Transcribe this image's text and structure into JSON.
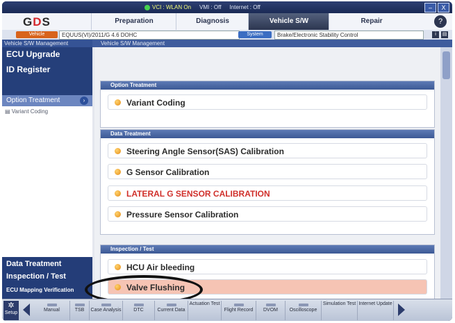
{
  "status": {
    "vci": "VCI : WLAN On",
    "vmi": "VMI : Off",
    "internet": "Internet : Off"
  },
  "window_controls": [
    "–",
    "X"
  ],
  "logo": {
    "text_dark": "G",
    "text_red": "D",
    "text_tail": "S"
  },
  "tabs": [
    {
      "label": "Preparation",
      "active": false
    },
    {
      "label": "Diagnosis",
      "active": false
    },
    {
      "label": "Vehicle S/W Management",
      "active": true
    },
    {
      "label": "Repair",
      "active": false
    }
  ],
  "help_icon": "?",
  "info": {
    "vehicle_button": "Vehicle",
    "vehicle_value": "EQUUS(VI)/2011/G 4.6 DOHC",
    "system_button": "System",
    "system_value": "Brake/Electronic Stability Control"
  },
  "sidebar": {
    "header": "Vehicle S/W Management",
    "ecu_upgrade": "ECU Upgrade",
    "id_register": "ID Register",
    "option_treatment": "Option Treatment",
    "sub_item": "Variant Coding",
    "data_treatment": "Data Treatment",
    "inspection_test": "Inspection / Test",
    "ecu_mapping": "ECU Mapping Verification"
  },
  "main": {
    "header": "Vehicle S/W Management",
    "sections": [
      {
        "title": "Option Treatment",
        "items": [
          "Variant Coding"
        ]
      },
      {
        "title": "Data Treatment",
        "items": [
          "Steering Angle Sensor(SAS) Calibration",
          "G Sensor Calibration",
          "LATERAL G SENSOR CALIBRATION",
          "Pressure Sensor Calibration"
        ]
      },
      {
        "title": "Inspection / Test",
        "items": [
          "HCU Air bleeding",
          "Valve Flushing"
        ]
      }
    ]
  },
  "toolbar": {
    "setup": "Setup",
    "buttons": [
      "Manual",
      "TSB",
      "Case Analysis",
      "DTC",
      "Current Data",
      "Actuation Test",
      "Flight Record",
      "DVOM",
      "Oscilloscope",
      "Simulation Test",
      "Internet Update"
    ]
  },
  "colors": {
    "accent_red": "#d0302b",
    "highlight": "#f6c4b4",
    "nav_blue": "#253f7a"
  }
}
